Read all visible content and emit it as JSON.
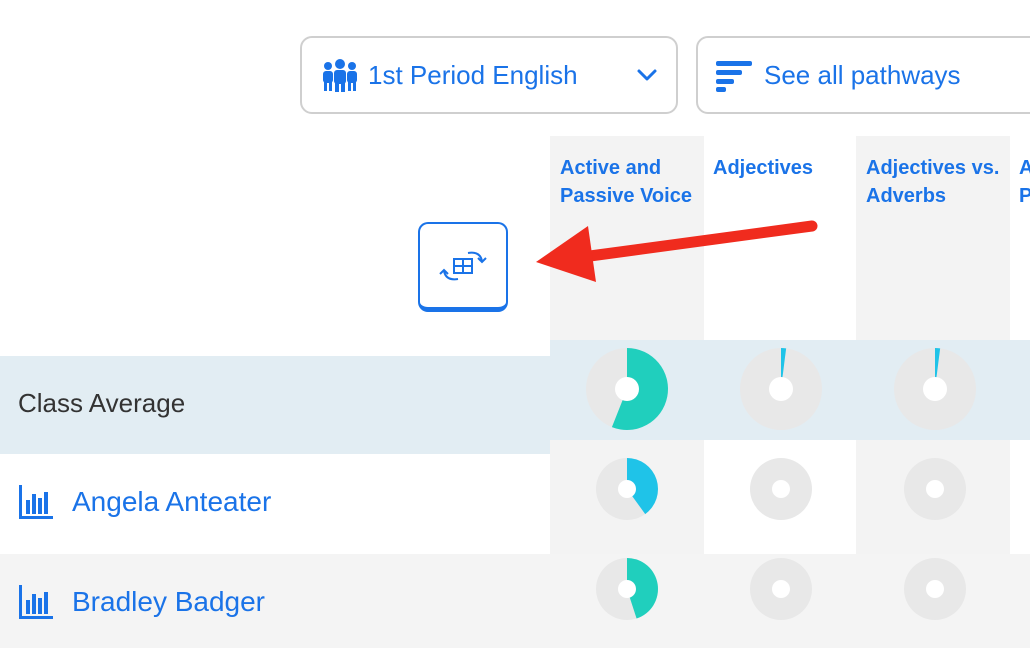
{
  "toolbar": {
    "class_select": {
      "selected": "1st Period English",
      "icon": "people-group-icon"
    },
    "pathway_select": {
      "label": "See all pathways",
      "icon": "filter-lines-icon"
    }
  },
  "columns": [
    {
      "label": "Active and Passive Voice"
    },
    {
      "label": "Adjectives"
    },
    {
      "label": "Adjectives vs. Adverbs"
    },
    {
      "label": "A P"
    }
  ],
  "switch_view_button": {
    "icon": "switch-view-icon"
  },
  "annotation": {
    "icon": "red-arrow-icon"
  },
  "rows": [
    {
      "name": "Class Average",
      "progress": [
        0.56,
        0.02,
        0.02
      ]
    },
    {
      "name": "Angela Anteater",
      "progress": [
        0.4,
        0.0,
        0.0
      ]
    },
    {
      "name": "Bradley Badger",
      "progress": [
        0.45,
        0.0,
        0.0
      ]
    }
  ],
  "colors": {
    "accent": "#1a73e8",
    "complete": "#20cfbd",
    "partial": "#1fc3e8",
    "track": "#e8e8e8",
    "annotation": "#f02b1e"
  }
}
